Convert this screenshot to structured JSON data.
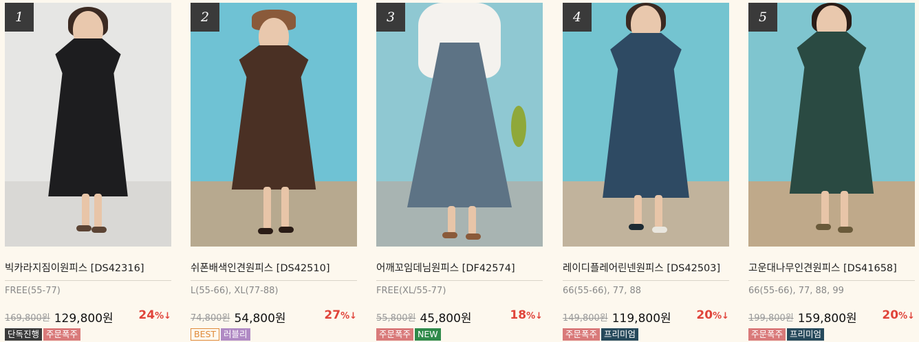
{
  "products": [
    {
      "rank": "1",
      "name": "빅카라지짐이원피스 [DS42316]",
      "sizes": "FREE(55-77)",
      "original_price": "169,800원",
      "sale_price": "129,800원",
      "discount": "24",
      "discount_unit": "%↓",
      "badges": [
        {
          "label": "단독진행",
          "style": "dark"
        },
        {
          "label": "주문폭주",
          "style": "pink"
        }
      ],
      "colors": {
        "background": "#e6e6e4",
        "dress": "#1d1d1f",
        "floor": "#d9d8d5"
      }
    },
    {
      "rank": "2",
      "name": "쉬폰배색인견원피스 [DS42510]",
      "sizes": "L(55-66), XL(77-88)",
      "original_price": "74,800원",
      "sale_price": "54,800원",
      "discount": "27",
      "discount_unit": "%↓",
      "badges": [
        {
          "label": "BEST",
          "style": "outline"
        },
        {
          "label": "러블리",
          "style": "purple"
        }
      ],
      "colors": {
        "background": "#6fc2d4",
        "dress": "#4a3024",
        "floor": "#b7a98f"
      }
    },
    {
      "rank": "3",
      "name": "어깨꼬임데님원피스 [DF42574]",
      "sizes": "FREE(XL/55-77)",
      "original_price": "55,800원",
      "sale_price": "45,800원",
      "discount": "18",
      "discount_unit": "%↓",
      "badges": [
        {
          "label": "주문폭주",
          "style": "pink"
        },
        {
          "label": "NEW",
          "style": "green"
        }
      ],
      "colors": {
        "background": "#8fc8d2",
        "dress": "#5d7385",
        "floor": "#a8b4b2"
      }
    },
    {
      "rank": "4",
      "name": "레이디플레어린넨원피스 [DS42503]",
      "sizes": "66(55-66), 77, 88",
      "original_price": "149,800원",
      "sale_price": "119,800원",
      "discount": "20",
      "discount_unit": "%↓",
      "badges": [
        {
          "label": "주문폭주",
          "style": "pink"
        },
        {
          "label": "프리미엄",
          "style": "navy"
        }
      ],
      "colors": {
        "background": "#74c4d0",
        "dress": "#2e4a63",
        "floor": "#c1b39c"
      }
    },
    {
      "rank": "5",
      "name": "고운대나무인견원피스 [DS41658]",
      "sizes": "66(55-66), 77, 88, 99",
      "original_price": "199,800원",
      "sale_price": "159,800원",
      "discount": "20",
      "discount_unit": "%↓",
      "badges": [
        {
          "label": "주문폭주",
          "style": "pink"
        },
        {
          "label": "프리미엄",
          "style": "navy"
        }
      ],
      "colors": {
        "background": "#7fc5cf",
        "dress": "#2a4a42",
        "floor": "#bfa98a"
      }
    }
  ]
}
